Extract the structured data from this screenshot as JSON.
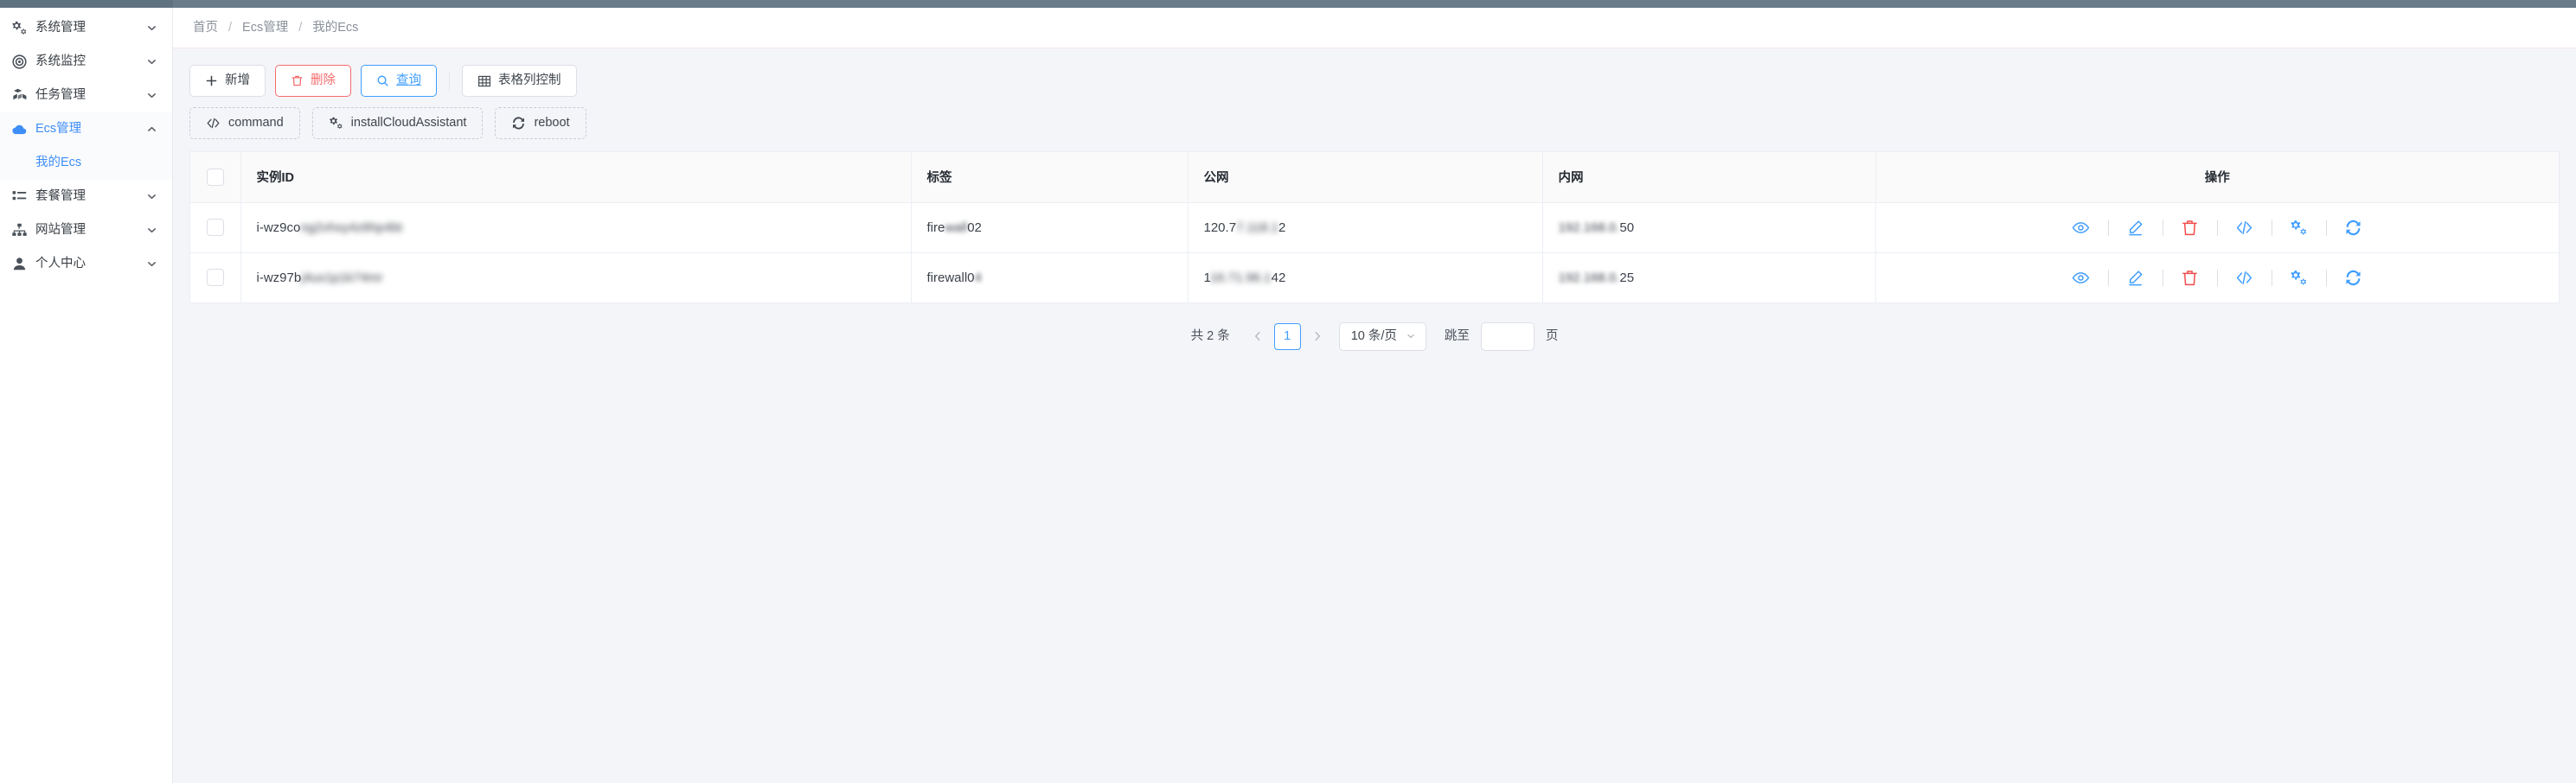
{
  "theme": {
    "accent": "#409eff",
    "danger": "#f56c6c",
    "topbar": "#677b88",
    "content_bg": "#f4f5f9",
    "link": "#3e8ef7"
  },
  "sidebar": {
    "items": [
      {
        "label": "系统管理",
        "icon": "gears-icon",
        "arrow": "chevron-down-icon",
        "active": false
      },
      {
        "label": "系统监控",
        "icon": "target-icon",
        "arrow": "chevron-down-icon",
        "active": false
      },
      {
        "label": "任务管理",
        "icon": "boxes-icon",
        "arrow": "chevron-down-icon",
        "active": false
      },
      {
        "label": "Ecs管理",
        "icon": "cloud-icon",
        "arrow": "chevron-up-icon",
        "active": true
      },
      {
        "label": "套餐管理",
        "icon": "list-icon",
        "arrow": "chevron-down-icon",
        "active": false
      },
      {
        "label": "网站管理",
        "icon": "sitemap-icon",
        "arrow": "chevron-down-icon",
        "active": false
      },
      {
        "label": "个人中心",
        "icon": "user-icon",
        "arrow": "chevron-down-icon",
        "active": false
      }
    ],
    "submenu": {
      "label": "我的Ecs",
      "parent": "Ecs管理"
    }
  },
  "breadcrumb": {
    "items": [
      "首页",
      "Ecs管理",
      "我的Ecs"
    ],
    "separator": "/"
  },
  "toolbar": {
    "primary_row": [
      {
        "label": "新增",
        "icon": "plus-icon",
        "style": "default"
      },
      {
        "label": "删除",
        "icon": "trash-icon",
        "style": "danger"
      },
      {
        "label": "查询",
        "icon": "search-icon",
        "style": "primary"
      },
      {
        "label": "表格列控制",
        "icon": "table-icon",
        "style": "default"
      }
    ],
    "secondary_row": [
      {
        "label": "command",
        "icon": "code-icon"
      },
      {
        "label": "installCloudAssistant",
        "icon": "gears-icon"
      },
      {
        "label": "reboot",
        "icon": "refresh-icon"
      }
    ]
  },
  "table": {
    "columns": [
      "实例ID",
      "标签",
      "公网",
      "内网",
      "操作"
    ],
    "rows": [
      {
        "checked": false,
        "instance_id_visible": "i-wz9co",
        "instance_id_redacted": "ng2vhxy4z6hp4bt",
        "tag_visible": "fire",
        "tag_redacted": "wall",
        "tag_tail": "02",
        "public_ip_visible": "120.7",
        "public_ip_redacted": "7.118.1",
        "public_ip_tail": "2",
        "private_ip_visible": "192.168.0.",
        "private_ip_tail": "50"
      },
      {
        "checked": false,
        "instance_id_visible": "i-wz97b",
        "instance_id_redacted": "j4ux1p1k74mr",
        "tag_visible": "firewall0",
        "tag_redacted": "4",
        "tag_tail": "",
        "public_ip_visible": "1",
        "public_ip_redacted": "16.71.96.1",
        "public_ip_tail": "42",
        "private_ip_visible": "192.168.0.",
        "private_ip_tail": "25"
      }
    ],
    "row_actions": [
      {
        "name": "view",
        "icon": "eye-icon",
        "color": "#409eff"
      },
      {
        "name": "edit",
        "icon": "pencil-icon",
        "color": "#409eff"
      },
      {
        "name": "delete",
        "icon": "trash-icon",
        "color": "#f24b4b"
      },
      {
        "name": "command",
        "icon": "code-icon",
        "color": "#409eff"
      },
      {
        "name": "install",
        "icon": "gears-icon",
        "color": "#409eff"
      },
      {
        "name": "reboot",
        "icon": "refresh-icon",
        "color": "#409eff"
      }
    ]
  },
  "pagination": {
    "total_text": "共 2 条",
    "prev_icon": "chevron-left-icon",
    "next_icon": "chevron-right-icon",
    "current_page": "1",
    "page_size_label": "10 条/页",
    "jump_label": "跳至",
    "jump_value": "",
    "jump_suffix": "页"
  }
}
